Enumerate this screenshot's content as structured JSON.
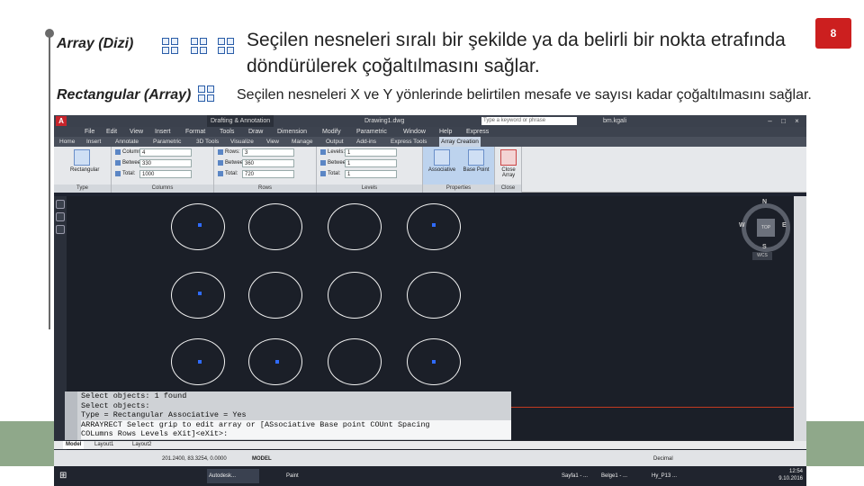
{
  "slide": {
    "page_number": "8",
    "section1": {
      "title": "Array (Dizi)",
      "description": "Seçilen nesneleri sıralı bir şekilde ya da belirli bir nokta etrafında döndürülerek çoğaltılmasını sağlar."
    },
    "section2": {
      "title": "Rectangular (Array)",
      "description": "Seçilen nesneleri X ve Y yönlerinde belirtilen mesafe ve sayısı kadar çoğaltılmasını sağlar."
    }
  },
  "app": {
    "title": "Drawing1.dwg",
    "workspace": "Drafting & Annotation",
    "search_placeholder": "Type a keyword or phrase",
    "user": "bm.kgali",
    "menu": [
      "File",
      "Edit",
      "View",
      "Insert",
      "Format",
      "Tools",
      "Draw",
      "Dimension",
      "Modify",
      "Parametric",
      "Window",
      "Help",
      "Express"
    ],
    "ribbon_tabs": [
      "Home",
      "Insert",
      "Annotate",
      "Parametric",
      "3D Tools",
      "Visualize",
      "View",
      "Manage",
      "Output",
      "Add-ins",
      "Express Tools",
      "Array Creation"
    ],
    "active_tab": "Array Creation",
    "ribbon": {
      "type_button": "Rectangular",
      "type_label": "Type",
      "columns": {
        "label": "Columns",
        "columns_lbl": "Columns:",
        "columns_val": "4",
        "between_lbl": "Between:",
        "between_val": "330",
        "total_lbl": "Total:",
        "total_val": "1000"
      },
      "rows": {
        "label": "Rows",
        "rows_lbl": "Rows:",
        "rows_val": "3",
        "between_lbl": "Between:",
        "between_val": "360",
        "total_lbl": "Total:",
        "total_val": "720"
      },
      "levels": {
        "label": "Levels",
        "levels_lbl": "Levels:",
        "levels_val": "1",
        "between_lbl": "Between:",
        "between_val": "1",
        "total_lbl": "Total:",
        "total_val": "1"
      },
      "properties": {
        "label": "Properties",
        "associative": "Associative",
        "base_point": "Base Point"
      },
      "close": {
        "label": "Close",
        "button": "Close Array"
      }
    },
    "viewcube": {
      "top": "TOP",
      "n": "N",
      "s": "S",
      "e": "E",
      "w": "W",
      "wcs": "WCS"
    },
    "command_lines": [
      "Select objects: 1 found",
      "Select objects:",
      "Type = Rectangular  Associative = Yes",
      "ARRAYRECT Select grip to edit array or [ASsociative Base point COUnt Spacing",
      "COLumns Rows Levels eXit]<eXit>:"
    ],
    "layout_tabs": [
      "Model",
      "Layout1",
      "Layout2"
    ],
    "status": {
      "coords": "201.2400, 83.3254, 0.0000",
      "mode": "MODEL",
      "units": "Decimal"
    },
    "taskbar": {
      "apps": [
        "Autodesk...",
        "Paint",
        "Sayfa1 - ...",
        "Belge1 - ...",
        "Hy_P13 ..."
      ],
      "time": "12:54",
      "date": "9.10.2016"
    }
  }
}
